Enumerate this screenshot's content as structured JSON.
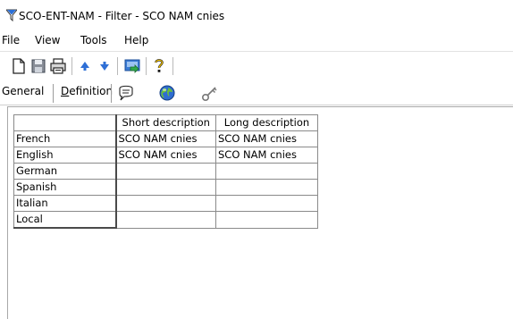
{
  "window": {
    "title": "SCO-ENT-NAM - Filter - SCO NAM cnies"
  },
  "menu": [
    "File",
    "View",
    "Tools",
    "Help"
  ],
  "toolbar": {
    "icons": [
      "new-document-icon",
      "save-icon",
      "print-icon",
      "move-up-icon",
      "move-down-icon",
      "export-icon",
      "help-icon"
    ]
  },
  "tabs": {
    "general": "General",
    "definition_mnemonic": "D",
    "definition_rest": "efinition",
    "icon_tabs": [
      "comment-icon",
      "globe-icon",
      "key-icon"
    ]
  },
  "table": {
    "columns": [
      "",
      "Short description",
      "Long description"
    ],
    "rows": [
      {
        "language": "French",
        "short": "SCO NAM cnies",
        "long": "SCO NAM cnies"
      },
      {
        "language": "English",
        "short": "SCO NAM cnies",
        "long": "SCO NAM cnies"
      },
      {
        "language": "German",
        "short": "",
        "long": ""
      },
      {
        "language": "Spanish",
        "short": "",
        "long": ""
      },
      {
        "language": "Italian",
        "short": "",
        "long": ""
      },
      {
        "language": "Local",
        "short": "",
        "long": ""
      }
    ]
  }
}
